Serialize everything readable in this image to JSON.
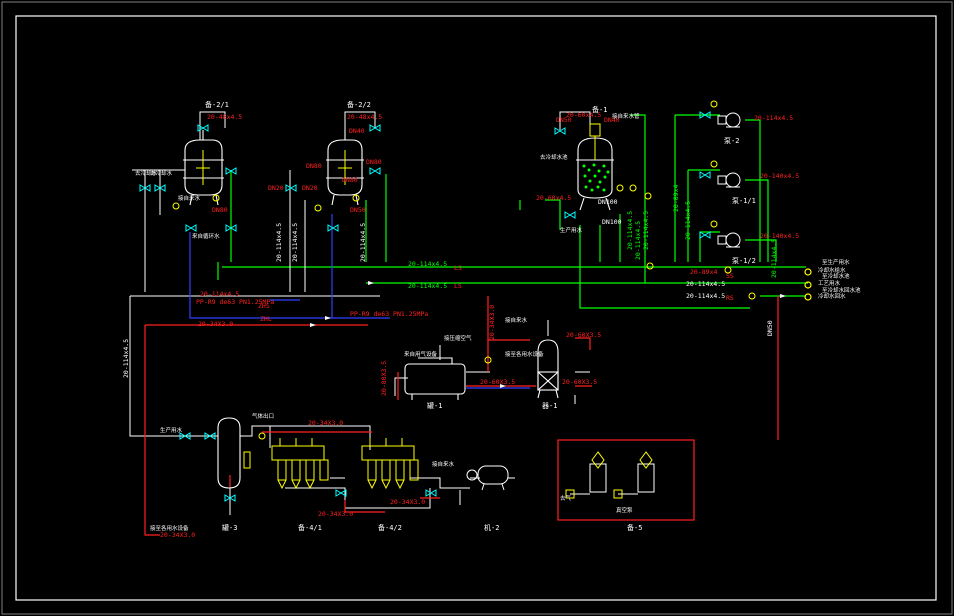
{
  "colors": {
    "background": "#000000",
    "frame": "#ffffff",
    "equipment": "#ffffff",
    "instrument": "#ffff00",
    "green_line": "#00ff00",
    "red_line": "#ff2020",
    "blue_line": "#3040ff",
    "valve": "#00ffff",
    "label_red": "#ff0000",
    "label_yellow": "#ffff00",
    "label_white": "#ffffff"
  },
  "tags": {
    "r21": "备-2/1",
    "r22": "备-2/2",
    "r1": "备-1",
    "p2": "泵-2",
    "p11": "泵-1/1",
    "p12": "泵-1/2",
    "t1": "罐-1",
    "f1": "器-1",
    "v3": "罐-3",
    "m41": "备-4/1",
    "m42": "备-4/2",
    "c2": "机-2",
    "g5": "备-5"
  },
  "sizes": {
    "s1": "20-48x4.5",
    "s2": "20-48x4.5",
    "s3": "20-60x4.5",
    "s4": "20-60x4.5",
    "s5": "20-114x4.5",
    "s6": "20-114x4.5",
    "s7": "20-114x4.5",
    "s8": "20-114x4.5",
    "s9": "20-114x4.5",
    "s10": "20-114x4.5",
    "s11": "20-114x4.5",
    "s12": "20-89x4",
    "s13": "20-114x4.5",
    "s14": "20-114x4.5",
    "s15": "20-114x4.5",
    "s16": "20-114x4.5",
    "s17": "20-140x4.5",
    "s18": "20-140x4.5",
    "s19": "20-114x4.5",
    "s20": "20-114x4.5",
    "s21": "20-34X3.0",
    "s22": "20-34X3.0",
    "s23": "20-60X3.5",
    "s24": "20-60X3.5",
    "s25": "20-80X3.5",
    "s26": "20-60X3.5",
    "s27": "20-34X3.0",
    "s28": "20-34X3.0",
    "s29": "20-34X3.0",
    "s30": "20-34X3.0",
    "s31": "20-114x4.5",
    "s32": "PP-R9 de63 PN1.25MPa",
    "s33": "PP-R9 de63 PN1.25MPa",
    "s34": "20-89x4",
    "s35": "20-114x4.5"
  },
  "dn": {
    "d1": "DN40",
    "d2": "DN80",
    "d3": "DN80",
    "d4": "DN80",
    "d5": "DN20",
    "d6": "DN20",
    "d7": "DN80",
    "d8": "DN50",
    "d9": "DN50",
    "d10": "DN40",
    "d11": "DN100",
    "d12": "DN100",
    "d13": "DN50"
  },
  "streams": {
    "ls": "LS",
    "ls2": "LS",
    "ss": "SS",
    "rs": "RS",
    "zhs": "ZHS",
    "zhl": "ZHL"
  },
  "notes": {
    "n1": "去冷却水",
    "n2": "去冷却水",
    "n3": "接自来水",
    "n4": "来自循环水",
    "n5": "去冷却水池",
    "n6": "接自来水管",
    "n7": "生产用水",
    "n8": "冷却水给水",
    "n9": "工艺用水",
    "n10": "冷却水回水",
    "n11": "接压缩空气",
    "n12": "接自来水",
    "n13": "接至各用水设备",
    "n14": "来自用气设备",
    "n15": "接至各用水设备",
    "n16": "接自来水",
    "n17": "生产用水",
    "n18": "气体出口",
    "n19": "真空泵",
    "n20": "去气"
  },
  "destinations": {
    "o1": "至生产用水",
    "o2": "至冷却水池",
    "o3": "至冷却水回水池"
  }
}
